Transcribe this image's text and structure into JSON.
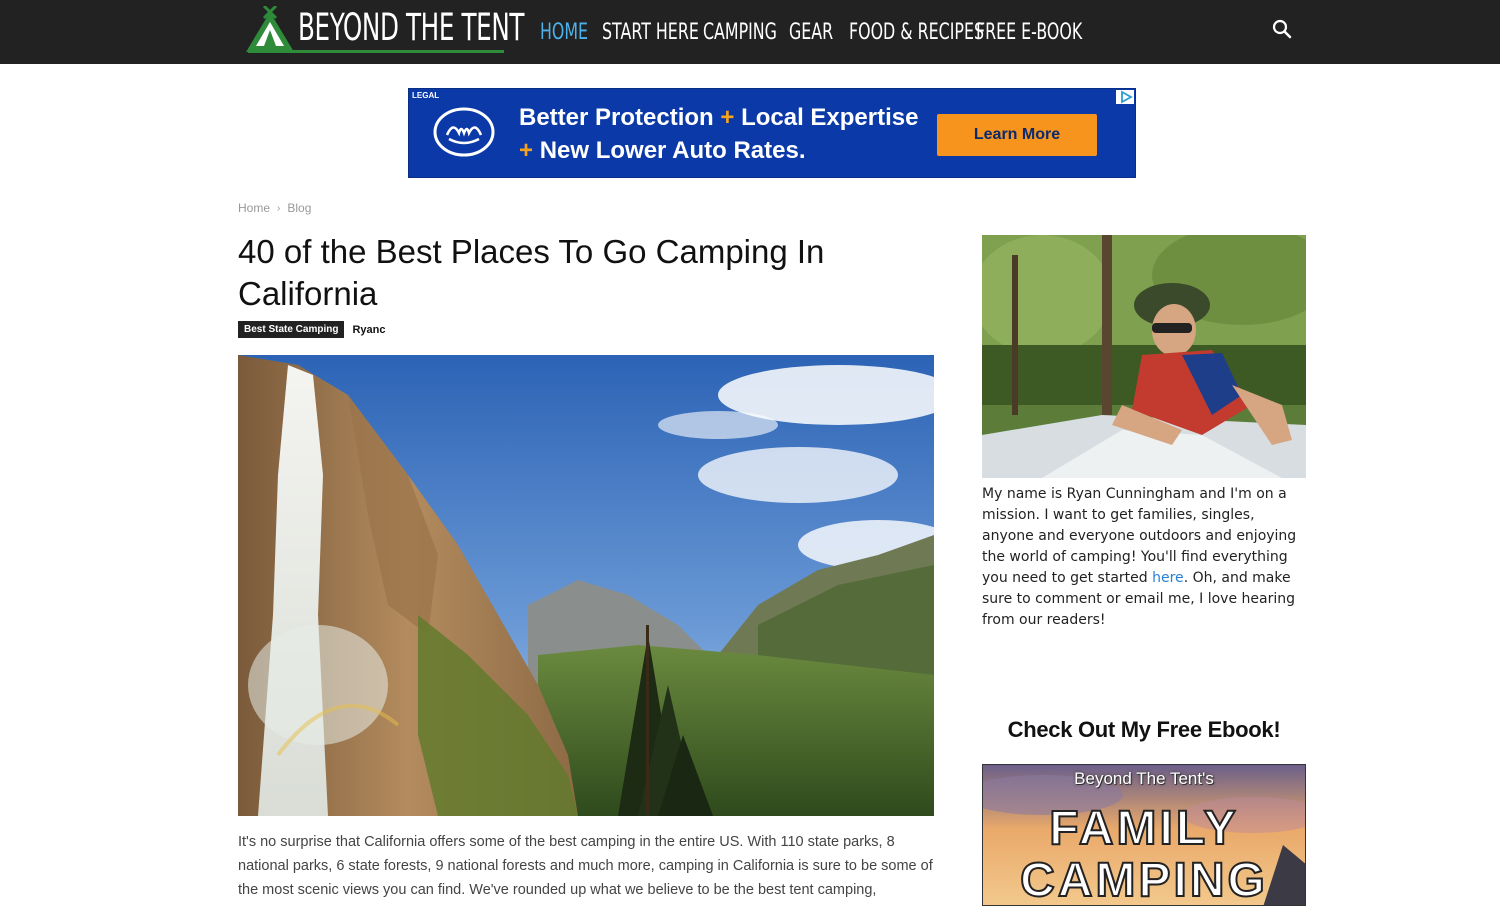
{
  "header": {
    "logo_text": "BEYOND THE TENT",
    "nav": [
      {
        "label": "HOME",
        "active": true
      },
      {
        "label": "START HERE"
      },
      {
        "label": "CAMPING"
      },
      {
        "label": "GEAR"
      },
      {
        "label": "FOOD & RECIPES"
      },
      {
        "label": "FREE E-BOOK"
      }
    ],
    "search_icon": "search-icon"
  },
  "ad": {
    "legal": "LEGAL",
    "line1_a": "Better Protection",
    "plus": "+",
    "line1_b": "Local Expertise",
    "line2": "New Lower Auto Rates.",
    "button": "Learn More",
    "brand_color": "#0b3aa8",
    "button_color": "#f7941d"
  },
  "breadcrumb": {
    "home": "Home",
    "separator": "›",
    "current": "Blog"
  },
  "article": {
    "title": "40 of the Best Places To Go Camping In California",
    "category": "Best State Camping",
    "author": "Ryanc",
    "excerpt": "It's no surprise that California offers some of the best camping in the entire US. With 110 state parks, 8 national parks, 6 state forests, 9 national forests and much more, camping in California is sure to be some of the most scenic views you can find. We've rounded up what we believe to be the best tent camping,"
  },
  "sidebar": {
    "bio_before": "My name is Ryan Cunningham and I'm on a mission. I want to get families, singles, anyone and everyone outdoors and enjoying the world of camping! You'll find everything you need to get started ",
    "bio_link": "here",
    "bio_after": ". Oh, and make sure to comment or email me, I love hearing from our readers!",
    "ebook_heading": "Check Out My Free Ebook!",
    "cover_small": "Beyond The Tent's",
    "cover_line1": "FAMILY",
    "cover_line2": "CAMPING"
  },
  "colors": {
    "topbar": "#222222",
    "nav_active": "#4db2ec",
    "link": "#2a7fd4"
  }
}
